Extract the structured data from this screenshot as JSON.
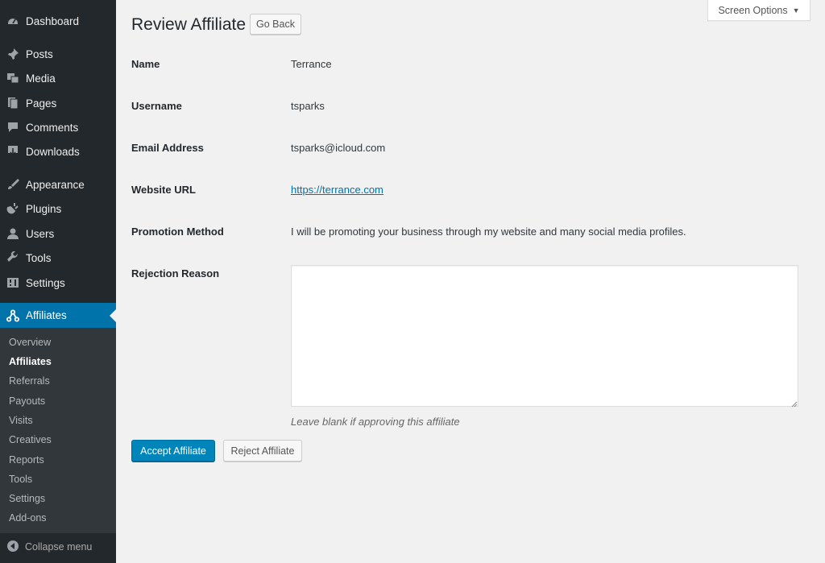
{
  "sidebar": {
    "menu": [
      {
        "label": "Dashboard",
        "icon": "dashboard-icon"
      },
      {
        "label": "Posts",
        "icon": "pin-icon"
      },
      {
        "label": "Media",
        "icon": "media-icon"
      },
      {
        "label": "Pages",
        "icon": "pages-icon"
      },
      {
        "label": "Comments",
        "icon": "comment-icon"
      },
      {
        "label": "Downloads",
        "icon": "download-icon"
      },
      {
        "label": "Appearance",
        "icon": "paintbrush-icon"
      },
      {
        "label": "Plugins",
        "icon": "plug-icon"
      },
      {
        "label": "Users",
        "icon": "user-icon"
      },
      {
        "label": "Tools",
        "icon": "wrench-icon"
      },
      {
        "label": "Settings",
        "icon": "settings-icon"
      },
      {
        "label": "Affiliates",
        "icon": "affiliate-network-icon"
      }
    ],
    "submenu": [
      "Overview",
      "Affiliates",
      "Referrals",
      "Payouts",
      "Visits",
      "Creatives",
      "Reports",
      "Tools",
      "Settings",
      "Add-ons"
    ],
    "current_submenu": "Affiliates",
    "collapse_label": "Collapse menu"
  },
  "header": {
    "screen_options_label": "Screen Options",
    "title": "Review Affiliate",
    "go_back_label": "Go Back"
  },
  "form": {
    "name_label": "Name",
    "name_value": "Terrance",
    "username_label": "Username",
    "username_value": "tsparks",
    "email_label": "Email Address",
    "email_value": "tsparks@icloud.com",
    "website_label": "Website URL",
    "website_value": "https://terrance.com",
    "promotion_label": "Promotion Method",
    "promotion_value": "I will be promoting your business through my website and many social media profiles.",
    "rejection_label": "Rejection Reason",
    "rejection_value": "",
    "rejection_hint": "Leave blank if approving this affiliate"
  },
  "actions": {
    "accept_label": "Accept Affiliate",
    "reject_label": "Reject Affiliate"
  },
  "colors": {
    "sidebar_bg": "#23282d",
    "submenu_bg": "#32373c",
    "accent": "#0073aa",
    "primary_button": "#0085ba",
    "content_bg": "#f1f1f1"
  }
}
